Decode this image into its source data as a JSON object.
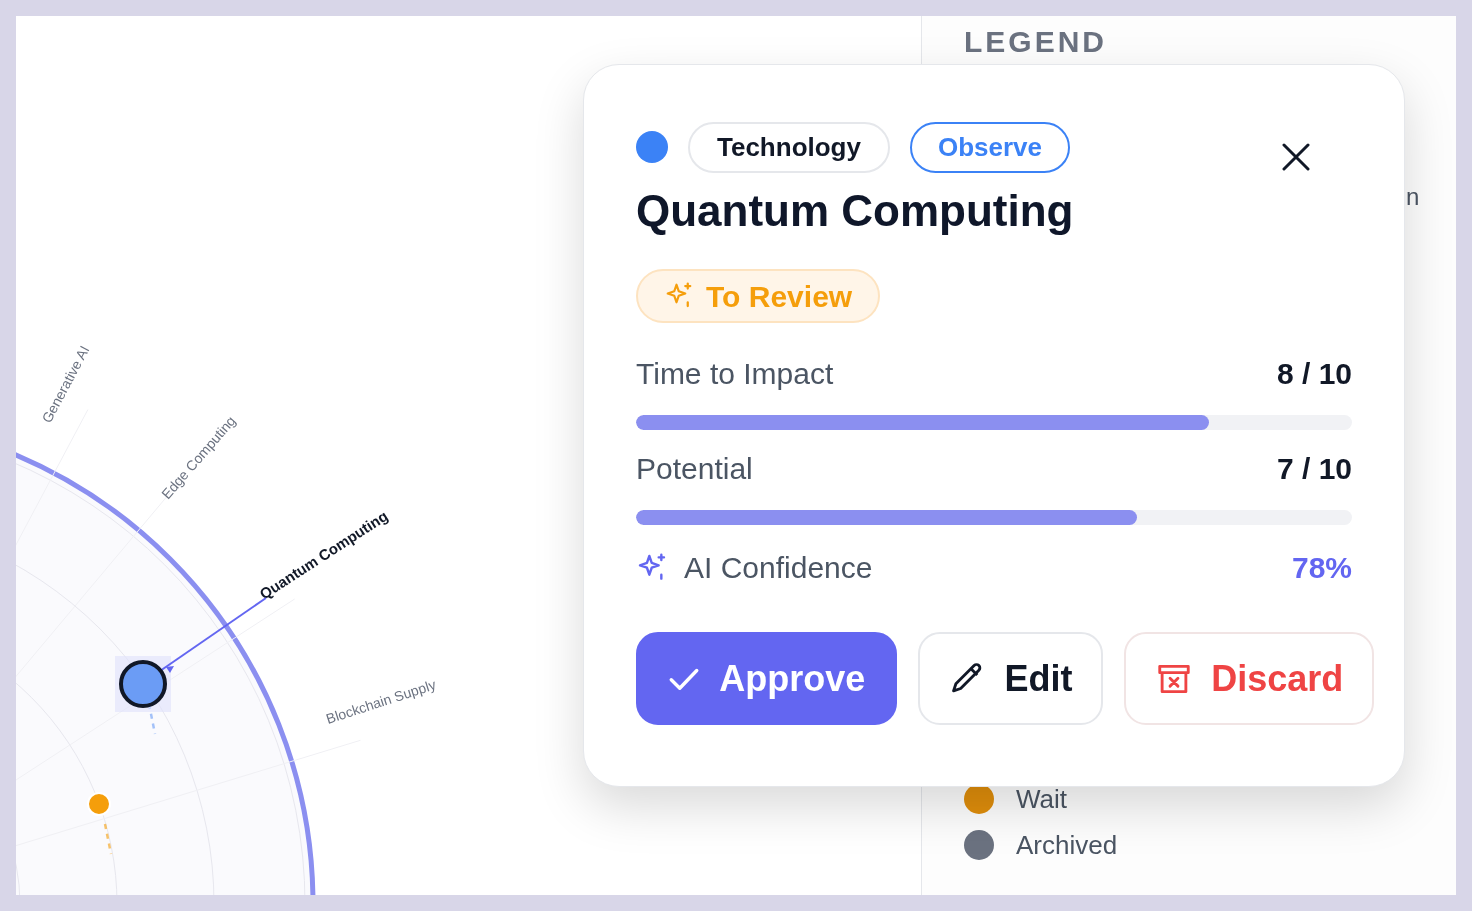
{
  "radar": {
    "labels": [
      {
        "text": "Generative AI",
        "selected": false
      },
      {
        "text": "Edge Computing",
        "selected": false
      },
      {
        "text": "Quantum Computing",
        "selected": true
      },
      {
        "text": "Blockchain Supply",
        "selected": false
      }
    ],
    "nodes": [
      {
        "color": "#6b9cf5",
        "selected": true
      },
      {
        "color": "#f59e0b",
        "selected": false
      }
    ]
  },
  "legend": {
    "title": "LEGEND",
    "cut_label": "n",
    "items": [
      {
        "label": "Wait",
        "color": "#e08e0b"
      },
      {
        "label": "Archived",
        "color": "#6b7280"
      }
    ]
  },
  "card": {
    "color": "#3b82f6",
    "category": "Technology",
    "ring": "Observe",
    "title": "Quantum Computing",
    "status": "To Review",
    "metrics": [
      {
        "label": "Time to Impact",
        "value": "8 / 10",
        "level": 0.8
      },
      {
        "label": "Potential",
        "value": "7 / 10",
        "level": 0.7
      }
    ],
    "confidence": {
      "label": "AI Confidence",
      "value": "78%"
    },
    "buttons": [
      {
        "kind": "approve",
        "label": "Approve"
      },
      {
        "kind": "edit",
        "label": "Edit"
      },
      {
        "kind": "discard",
        "label": "Discard"
      }
    ]
  }
}
